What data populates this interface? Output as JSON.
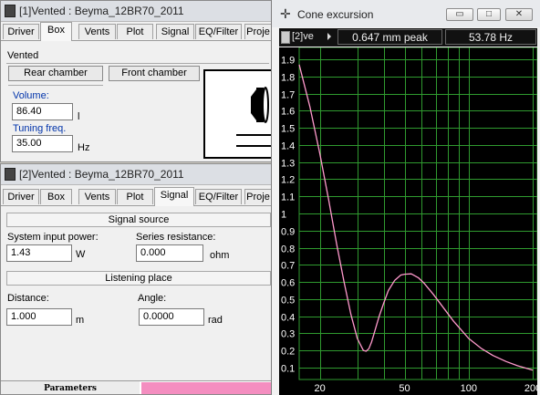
{
  "win1": {
    "title": "[1]Vented : Beyma_12BR70_2011",
    "tabs": [
      "Driver",
      "Box",
      "Vents",
      "Plot",
      "Signal",
      "EQ/Filter",
      "Proje"
    ],
    "active_tab": "Box",
    "box_type": "Vented",
    "rear_chamber_label": "Rear chamber",
    "front_chamber_label": "Front chamber",
    "volume_label": "Volume:",
    "volume_value": "86.40",
    "volume_unit": "l",
    "tuning_label": "Tuning freq.",
    "tuning_value": "35.00",
    "tuning_unit": "Hz"
  },
  "win2": {
    "title": "[2]Vented : Beyma_12BR70_2011",
    "tabs": [
      "Driver",
      "Box",
      "Vents",
      "Plot",
      "Signal",
      "EQ/Filter",
      "Proje"
    ],
    "active_tab": "Signal",
    "signal_source_header": "Signal source",
    "power_label": "System input power:",
    "power_value": "1.43",
    "power_unit": "W",
    "resistance_label": "Series resistance:",
    "resistance_value": "0.000",
    "resistance_unit": "ohm",
    "listening_header": "Listening place",
    "distance_label": "Distance:",
    "distance_value": "1.000",
    "distance_unit": "m",
    "angle_label": "Angle:",
    "angle_value": "0.0000",
    "angle_unit": "rad",
    "status_label": "Parameters"
  },
  "cone": {
    "title": "Cone excursion",
    "selector": "[2]ve",
    "peak": "0.647 mm peak",
    "freq": "53.78 Hz",
    "min_btn": "▭",
    "max_btn": "□",
    "close_btn": "✕"
  },
  "chart_data": {
    "type": "line",
    "title": "Cone excursion",
    "x_scale": "log",
    "xlim": [
      16,
      210
    ],
    "ylim": [
      0.03,
      1.97
    ],
    "x_ticks": [
      20,
      50,
      100,
      200
    ],
    "y_ticks": [
      0.1,
      0.2,
      0.3,
      0.4,
      0.5,
      0.6,
      0.7,
      0.8,
      0.9,
      1,
      1.1,
      1.2,
      1.3,
      1.4,
      1.5,
      1.6,
      1.7,
      1.8,
      1.9
    ],
    "grid": true,
    "colors": {
      "background": "#000000",
      "grid": "#2f9a2f",
      "line": "#ff99cc",
      "tick_labels": "#ffffff"
    },
    "series": [
      {
        "x": [
          16,
          18,
          20,
          22,
          24,
          26,
          28,
          30,
          32,
          33,
          34,
          35,
          36,
          38,
          40,
          42,
          45,
          48,
          50,
          53.78,
          58,
          62,
          68,
          75,
          85,
          100,
          115,
          130,
          150,
          170,
          200
        ],
        "y": [
          1.87,
          1.62,
          1.35,
          1.08,
          0.82,
          0.6,
          0.41,
          0.27,
          0.2,
          0.195,
          0.21,
          0.25,
          0.3,
          0.4,
          0.48,
          0.55,
          0.61,
          0.64,
          0.645,
          0.647,
          0.625,
          0.59,
          0.53,
          0.46,
          0.37,
          0.27,
          0.21,
          0.17,
          0.135,
          0.11,
          0.085
        ]
      }
    ]
  }
}
